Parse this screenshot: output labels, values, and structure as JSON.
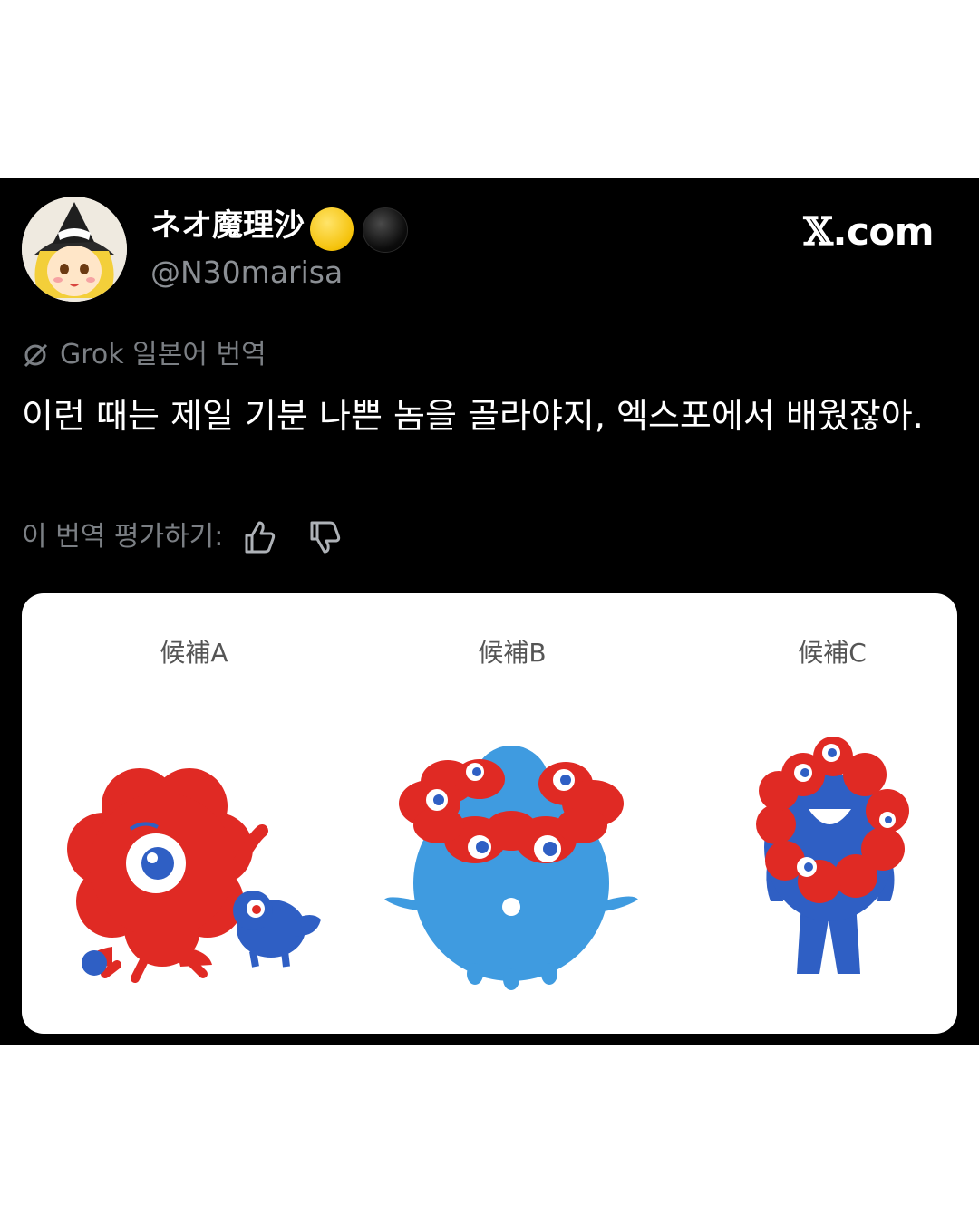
{
  "user": {
    "display_name": "ネオ魔理沙",
    "handle": "@N30marisa",
    "avatar_icon": "marisa-avatar-icon",
    "name_emojis": [
      "yellow-circle-icon",
      "black-circle-icon"
    ]
  },
  "brand": {
    "x": "𝕏",
    "domain": ".com"
  },
  "translation": {
    "label": "Grok 일본어 번역",
    "icon": "grok-icon"
  },
  "tweet": {
    "text": "이런 때는 제일 기분 나쁜 놈을 골라야지, 엑스포에서 배웠잖아."
  },
  "rating": {
    "label": "이 번역 평가하기:",
    "up_icon": "thumbs-up-icon",
    "down_icon": "thumbs-down-icon"
  },
  "media": {
    "candidates": [
      "候補A",
      "候補B",
      "候補C"
    ]
  },
  "colors": {
    "background": "#000000",
    "text": "#ffffff",
    "muted": "#7b7f84",
    "mascot_red": "#e02a24",
    "mascot_blue": "#2f5fc4",
    "mascot_light_blue": "#3f9be0"
  }
}
